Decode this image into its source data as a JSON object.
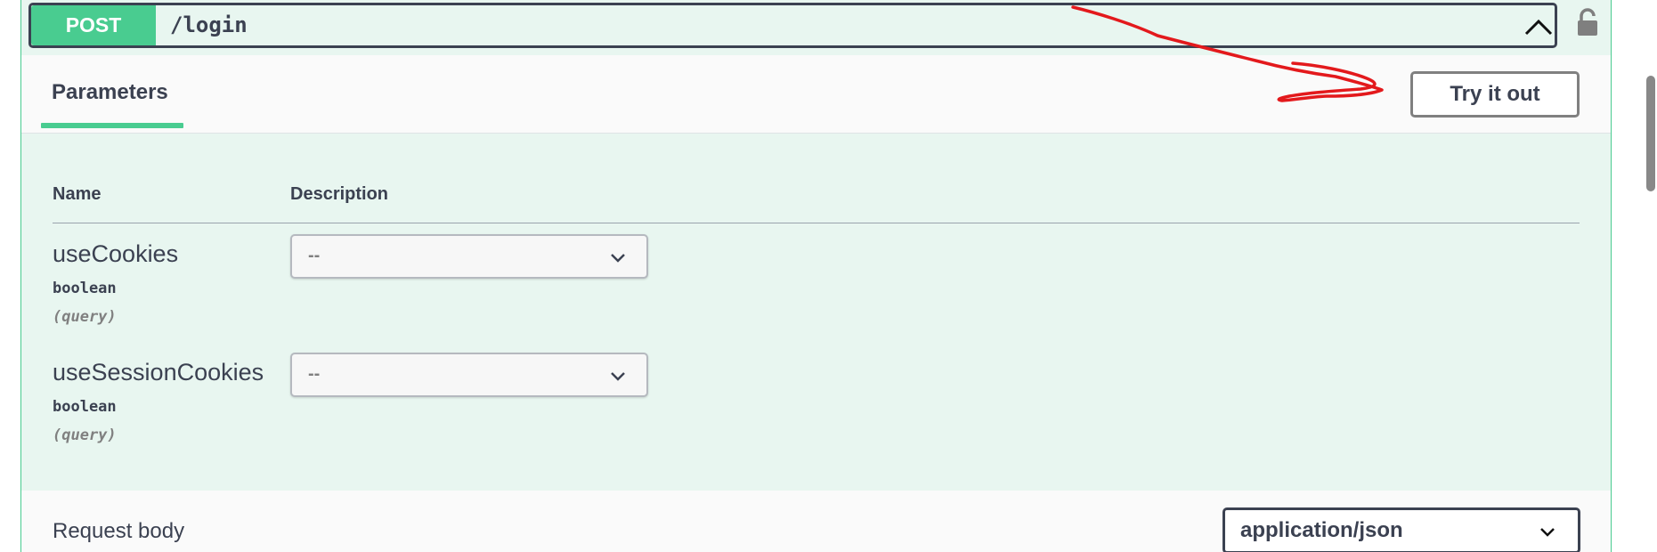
{
  "operation": {
    "method": "POST",
    "path": "/login",
    "collapse_icon": "chevron-up-icon",
    "lock_icon": "lock-open-icon"
  },
  "parameters_section": {
    "tab_label": "Parameters",
    "try_button_label": "Try it out",
    "columns": {
      "name": "Name",
      "description": "Description"
    },
    "params": [
      {
        "name": "useCookies",
        "type": "boolean",
        "in": "(query)",
        "selected": "--"
      },
      {
        "name": "useSessionCookies",
        "type": "boolean",
        "in": "(query)",
        "selected": "--"
      }
    ]
  },
  "request_body": {
    "label": "Request body",
    "content_type": "application/json"
  },
  "colors": {
    "post_green": "#49cc90",
    "block_background": "#e8f6f0",
    "text": "#3b4151",
    "annotation_red": "#e3191c"
  }
}
